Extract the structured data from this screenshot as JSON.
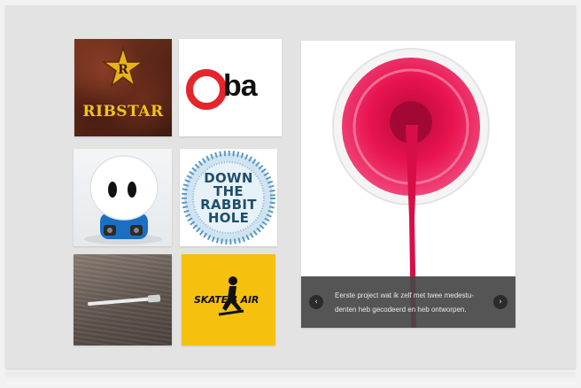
{
  "portfolio": {
    "tiles": [
      {
        "name": "ribstar",
        "label": "RIBSTAR",
        "star_letter": "R"
      },
      {
        "name": "oba",
        "label": "ba"
      },
      {
        "name": "robot"
      },
      {
        "name": "rabbit-hole",
        "lines": [
          "DOWN",
          "THE",
          "RABBIT",
          "HOLE"
        ]
      },
      {
        "name": "wood"
      },
      {
        "name": "skate4air",
        "label": "SKATE 4 AIR"
      }
    ]
  },
  "slider": {
    "caption": "Eerste project wat ik zelf met twee medestu-denten heb gecodeerd en heb ontworpen.",
    "prev_icon": "‹",
    "next_icon": "›"
  },
  "colors": {
    "background": "#e3e3e3",
    "paint": "#e8134f",
    "oba_red": "#e4262c",
    "skate_yellow": "#f5c10e",
    "caption_bar": "#464646"
  },
  "icons": {
    "prev": "chevron-left-icon",
    "next": "chevron-right-icon"
  }
}
